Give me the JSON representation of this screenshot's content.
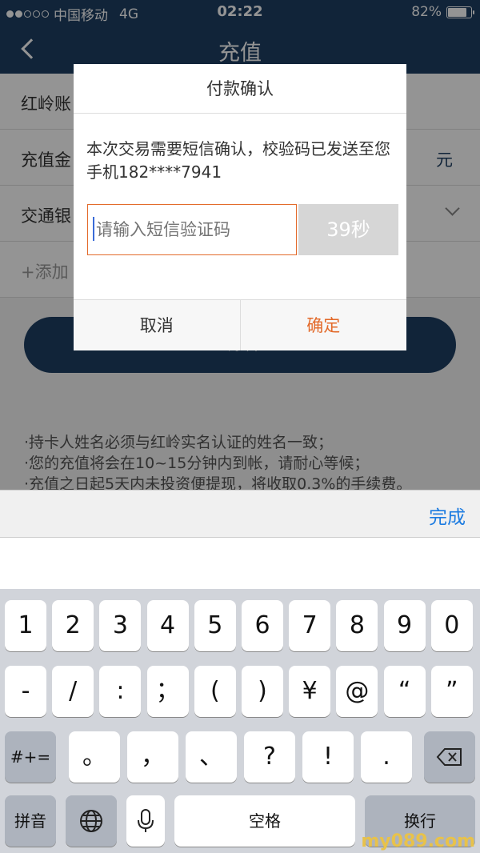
{
  "status": {
    "carrier": "中国移动",
    "network": "4G",
    "time": "02:22",
    "battery": "82%",
    "battery_level": 0.82
  },
  "nav": {
    "title": "充值"
  },
  "form": {
    "rows": [
      {
        "label": "红岭账"
      },
      {
        "label": "充值金",
        "unit": "元"
      },
      {
        "label": "交通银"
      },
      {
        "label": "+添加"
      }
    ],
    "confirm_label": "确认"
  },
  "notes": [
    "·持卡人姓名必须与红岭实名认证的姓名一致；",
    "·您的充值将会在10~15分钟内到帐，请耐心等候；",
    "·充值之日起5天内未投资便提现，将收取0.3%的手续费。"
  ],
  "dialog": {
    "title": "付款确认",
    "message": "本次交易需要短信确认，校验码已发送至您手机182****7941",
    "code_placeholder": "请输入短信验证码",
    "timer": "39秒",
    "cancel": "取消",
    "ok": "确定"
  },
  "keyboard": {
    "done": "完成",
    "row1": [
      "1",
      "2",
      "3",
      "4",
      "5",
      "6",
      "7",
      "8",
      "9",
      "0"
    ],
    "row2": [
      "-",
      "/",
      ":",
      "；",
      "(",
      ")",
      "¥",
      "@",
      "“",
      "”"
    ],
    "row3": [
      "。",
      "，",
      "、",
      "?",
      "!",
      "."
    ],
    "symbols": "#+=",
    "pinyin": "拼音",
    "space": "空格",
    "return": "换行"
  },
  "watermark": "my089.com"
}
